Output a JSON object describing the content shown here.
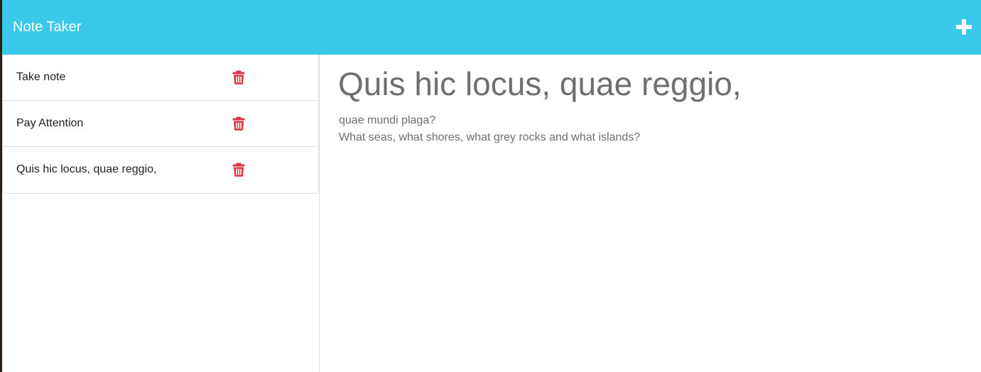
{
  "app": {
    "title": "Note Taker",
    "accent_color": "#3ac8eb",
    "delete_color": "#dc3545"
  },
  "toolbar": {
    "add_icon": "plus-icon"
  },
  "notes": [
    {
      "title": "Take note",
      "delete_icon": "trash-icon"
    },
    {
      "title": "Pay Attention",
      "delete_icon": "trash-icon"
    },
    {
      "title": "Quis hic locus, quae reggio,",
      "delete_icon": "trash-icon"
    }
  ],
  "active_note": {
    "title": "Quis hic locus, quae reggio,",
    "text_lines": [
      "quae mundi plaga?",
      "What seas, what shores, what grey rocks and what islands?"
    ]
  }
}
